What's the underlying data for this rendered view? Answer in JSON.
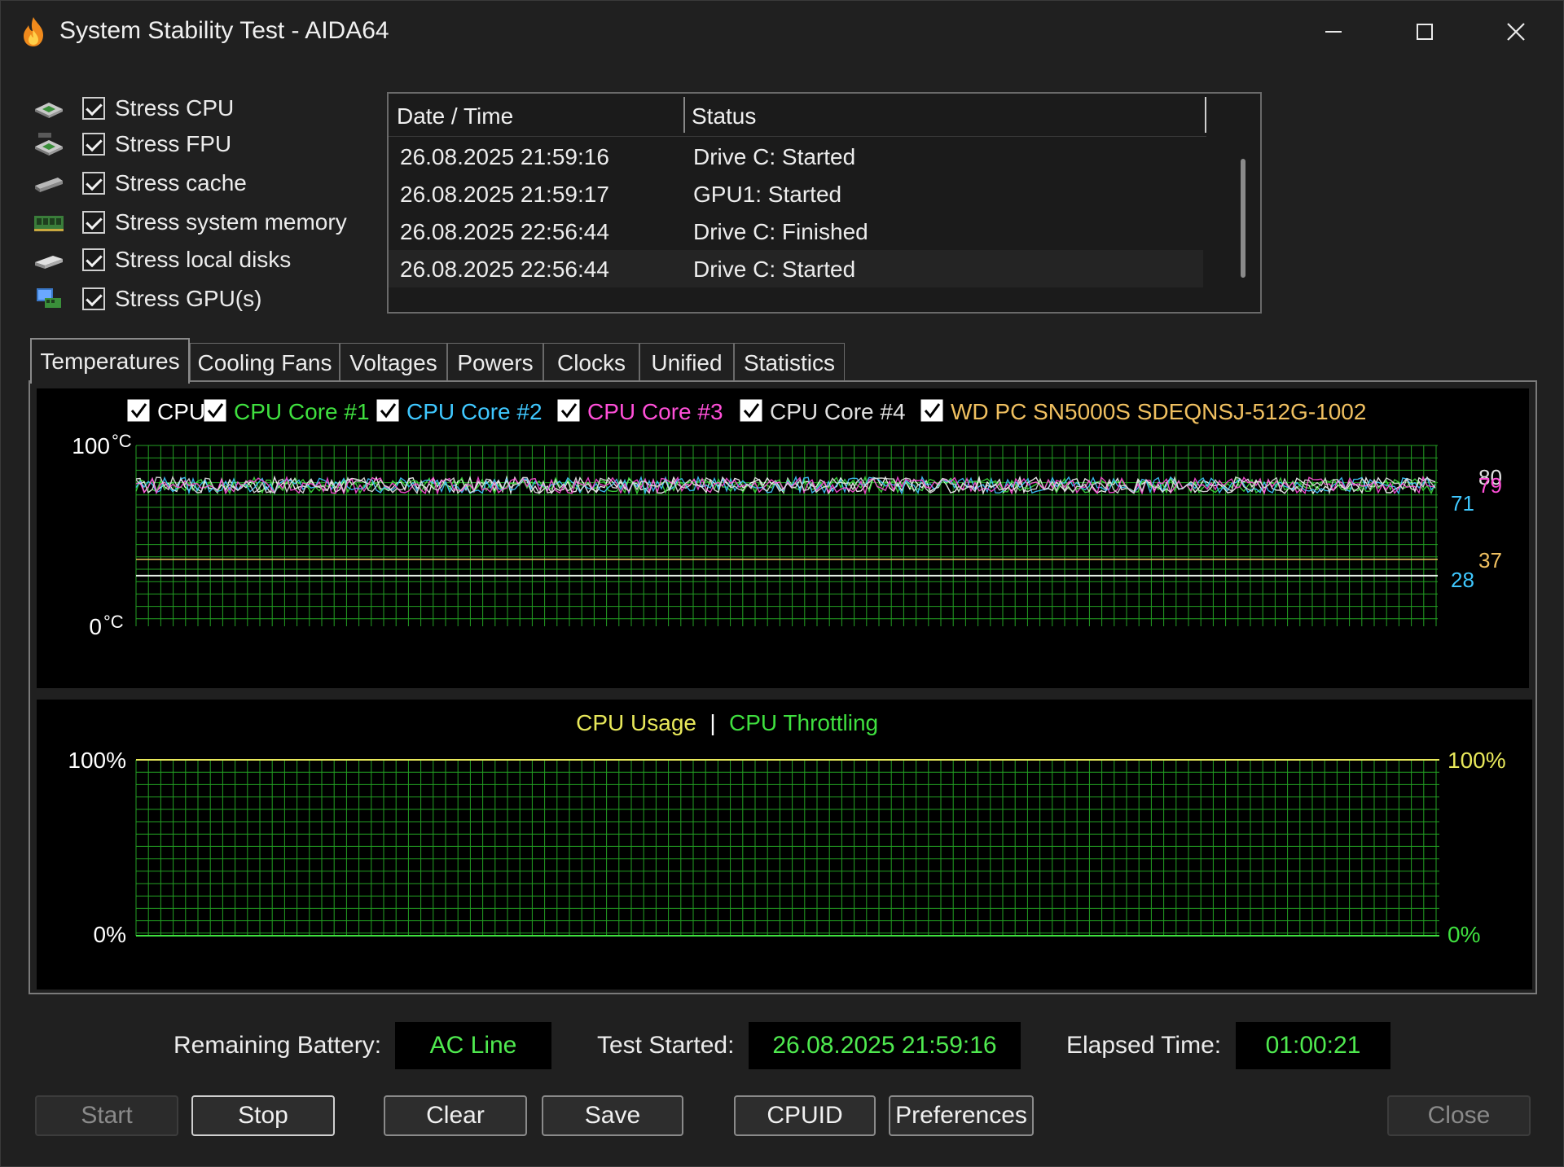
{
  "window": {
    "title": "System Stability Test - AIDA64",
    "app_icon": "flame-icon",
    "controls": {
      "minimize": "—",
      "maximize": "☐",
      "close": "✕"
    }
  },
  "stress_options": [
    {
      "label": "Stress CPU",
      "icon": "cpu-chip-icon",
      "checked": true
    },
    {
      "label": "Stress FPU",
      "icon": "fpu-chip-icon",
      "checked": true
    },
    {
      "label": "Stress cache",
      "icon": "cache-chip-icon",
      "checked": true
    },
    {
      "label": "Stress system memory",
      "icon": "memory-module-icon",
      "checked": true
    },
    {
      "label": "Stress local disks",
      "icon": "disk-drive-icon",
      "checked": true
    },
    {
      "label": "Stress GPU(s)",
      "icon": "gpu-monitor-icon",
      "checked": true
    }
  ],
  "log": {
    "columns": [
      "Date / Time",
      "Status"
    ],
    "rows": [
      {
        "datetime": "26.08.2025 21:59:16",
        "status": "Drive C: Started"
      },
      {
        "datetime": "26.08.2025 21:59:17",
        "status": "GPU1: Started"
      },
      {
        "datetime": "26.08.2025 22:56:44",
        "status": "Drive C: Finished"
      },
      {
        "datetime": "26.08.2025 22:56:44",
        "status": "Drive C: Started"
      }
    ]
  },
  "tabs": [
    {
      "label": "Temperatures",
      "active": true
    },
    {
      "label": "Cooling Fans",
      "active": false
    },
    {
      "label": "Voltages",
      "active": false
    },
    {
      "label": "Powers",
      "active": false
    },
    {
      "label": "Clocks",
      "active": false
    },
    {
      "label": "Unified",
      "active": false
    },
    {
      "label": "Statistics",
      "active": false
    }
  ],
  "temperature_graph": {
    "legend": [
      {
        "label": "CPU",
        "color": "#ffffff",
        "checked": true
      },
      {
        "label": "CPU Core #1",
        "color": "#3fe03f",
        "checked": true
      },
      {
        "label": "CPU Core #2",
        "color": "#3fc8ff",
        "checked": true
      },
      {
        "label": "CPU Core #3",
        "color": "#ff4fd8",
        "checked": true
      },
      {
        "label": "CPU Core #4",
        "color": "#e0e0e0",
        "checked": true
      },
      {
        "label": "WD PC SN5000S SDEQNSJ-512G-1002",
        "color": "#f0c060",
        "checked": true
      }
    ],
    "y_max_label": "100",
    "y_min_label": "0",
    "unit": "°C",
    "y_range": [
      0,
      100
    ],
    "current_values": [
      "80",
      "79",
      "71",
      "37",
      "28"
    ],
    "grid_color": "#23a023"
  },
  "usage_graph": {
    "title_usage": "CPU Usage",
    "separator": "|",
    "title_throttling": "CPU Throttling",
    "usage_color": "#e8e85a",
    "throttling_color": "#3fe03f",
    "y_max_left": "100%",
    "y_min_left": "0%",
    "y_max_right": "100%",
    "y_min_right": "0%",
    "cpu_usage_percent": 100,
    "throttling_percent": 0
  },
  "info": {
    "battery_label": "Remaining Battery:",
    "battery_value": "AC Line",
    "started_label": "Test Started:",
    "started_value": "26.08.2025 21:59:16",
    "elapsed_label": "Elapsed Time:",
    "elapsed_value": "01:00:21"
  },
  "buttons": {
    "start": "Start",
    "stop": "Stop",
    "clear": "Clear",
    "save": "Save",
    "cpuid": "CPUID",
    "preferences": "Preferences",
    "close": "Close"
  }
}
